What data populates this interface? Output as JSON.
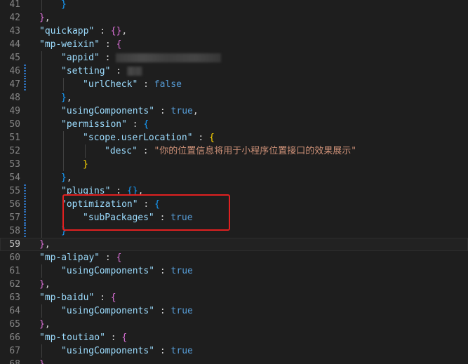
{
  "editor": {
    "highlight_color": "#e02020",
    "current_line": "59",
    "lines": [
      {
        "n": "41",
        "d": 2,
        "code": [
          {
            "t": "}",
            "c": "b2"
          }
        ]
      },
      {
        "n": "42",
        "d": 1,
        "code": [
          {
            "t": "}",
            "c": "b1"
          },
          {
            "t": ",",
            "c": "punc"
          }
        ]
      },
      {
        "n": "43",
        "d": 1,
        "code": [
          {
            "t": "\"quickapp\"",
            "c": "key"
          },
          {
            "t": " : ",
            "c": "punc"
          },
          {
            "t": "{}",
            "c": "b1"
          },
          {
            "t": ",",
            "c": "punc"
          }
        ]
      },
      {
        "n": "44",
        "d": 1,
        "code": [
          {
            "t": "\"mp-weixin\"",
            "c": "key"
          },
          {
            "t": " : ",
            "c": "punc"
          },
          {
            "t": "{",
            "c": "b1"
          }
        ]
      },
      {
        "n": "45",
        "d": 2,
        "code": [
          {
            "t": "\"appid\"",
            "c": "key"
          },
          {
            "t": " : ",
            "c": "punc"
          },
          {
            "redact": 150
          }
        ]
      },
      {
        "n": "46",
        "d": 2,
        "code": [
          {
            "t": "\"setting\"",
            "c": "key"
          },
          {
            "t": " : ",
            "c": "punc"
          },
          {
            "redact": 22
          }
        ]
      },
      {
        "n": "47",
        "d": 3,
        "code": [
          {
            "t": "\"urlCheck\"",
            "c": "key"
          },
          {
            "t": " : ",
            "c": "punc"
          },
          {
            "t": "false",
            "c": "bool"
          }
        ]
      },
      {
        "n": "48",
        "d": 2,
        "code": [
          {
            "t": "}",
            "c": "b2"
          },
          {
            "t": ",",
            "c": "punc"
          }
        ]
      },
      {
        "n": "49",
        "d": 2,
        "code": [
          {
            "t": "\"usingComponents\"",
            "c": "key"
          },
          {
            "t": " : ",
            "c": "punc"
          },
          {
            "t": "true",
            "c": "bool"
          },
          {
            "t": ",",
            "c": "punc"
          }
        ]
      },
      {
        "n": "50",
        "d": 2,
        "code": [
          {
            "t": "\"permission\"",
            "c": "key"
          },
          {
            "t": " : ",
            "c": "punc"
          },
          {
            "t": "{",
            "c": "b2"
          }
        ]
      },
      {
        "n": "51",
        "d": 3,
        "code": [
          {
            "t": "\"scope.userLocation\"",
            "c": "key"
          },
          {
            "t": " : ",
            "c": "punc"
          },
          {
            "t": "{",
            "c": "b3"
          }
        ]
      },
      {
        "n": "52",
        "d": 4,
        "code": [
          {
            "t": "\"desc\"",
            "c": "key"
          },
          {
            "t": " : ",
            "c": "punc"
          },
          {
            "t": "\"你的位置信息将用于小程序位置接口的效果展示\"",
            "c": "str"
          }
        ]
      },
      {
        "n": "53",
        "d": 3,
        "code": [
          {
            "t": "}",
            "c": "b3"
          }
        ]
      },
      {
        "n": "54",
        "d": 2,
        "code": [
          {
            "t": "}",
            "c": "b2"
          },
          {
            "t": ",",
            "c": "punc"
          }
        ]
      },
      {
        "n": "55",
        "d": 2,
        "code": [
          {
            "t": "\"plugins\"",
            "c": "key"
          },
          {
            "t": " : ",
            "c": "punc"
          },
          {
            "t": "{}",
            "c": "b2"
          },
          {
            "t": ",",
            "c": "punc"
          }
        ]
      },
      {
        "n": "56",
        "d": 2,
        "code": [
          {
            "t": "\"optimization\"",
            "c": "key"
          },
          {
            "t": " : ",
            "c": "punc"
          },
          {
            "t": "{",
            "c": "b2"
          }
        ]
      },
      {
        "n": "57",
        "d": 3,
        "code": [
          {
            "t": "\"subPackages\"",
            "c": "key"
          },
          {
            "t": " : ",
            "c": "punc"
          },
          {
            "t": "true",
            "c": "bool"
          }
        ]
      },
      {
        "n": "58",
        "d": 2,
        "code": [
          {
            "t": "}",
            "c": "b2"
          }
        ]
      },
      {
        "n": "59",
        "d": 1,
        "code": [
          {
            "t": "}",
            "c": "b1"
          },
          {
            "t": ",",
            "c": "punc"
          }
        ]
      },
      {
        "n": "60",
        "d": 1,
        "code": [
          {
            "t": "\"mp-alipay\"",
            "c": "key"
          },
          {
            "t": " : ",
            "c": "punc"
          },
          {
            "t": "{",
            "c": "b1"
          }
        ]
      },
      {
        "n": "61",
        "d": 2,
        "code": [
          {
            "t": "\"usingComponents\"",
            "c": "key"
          },
          {
            "t": " : ",
            "c": "punc"
          },
          {
            "t": "true",
            "c": "bool"
          }
        ]
      },
      {
        "n": "62",
        "d": 1,
        "code": [
          {
            "t": "}",
            "c": "b1"
          },
          {
            "t": ",",
            "c": "punc"
          }
        ]
      },
      {
        "n": "63",
        "d": 1,
        "code": [
          {
            "t": "\"mp-baidu\"",
            "c": "key"
          },
          {
            "t": " : ",
            "c": "punc"
          },
          {
            "t": "{",
            "c": "b1"
          }
        ]
      },
      {
        "n": "64",
        "d": 2,
        "code": [
          {
            "t": "\"usingComponents\"",
            "c": "key"
          },
          {
            "t": " : ",
            "c": "punc"
          },
          {
            "t": "true",
            "c": "bool"
          }
        ]
      },
      {
        "n": "65",
        "d": 1,
        "code": [
          {
            "t": "}",
            "c": "b1"
          },
          {
            "t": ",",
            "c": "punc"
          }
        ]
      },
      {
        "n": "66",
        "d": 1,
        "code": [
          {
            "t": "\"mp-toutiao\"",
            "c": "key"
          },
          {
            "t": " : ",
            "c": "punc"
          },
          {
            "t": "{",
            "c": "b1"
          }
        ]
      },
      {
        "n": "67",
        "d": 2,
        "code": [
          {
            "t": "\"usingComponents\"",
            "c": "key"
          },
          {
            "t": " : ",
            "c": "punc"
          },
          {
            "t": "true",
            "c": "bool"
          }
        ]
      },
      {
        "n": "68",
        "d": 1,
        "code": [
          {
            "t": "}",
            "c": "b1"
          }
        ]
      }
    ]
  }
}
